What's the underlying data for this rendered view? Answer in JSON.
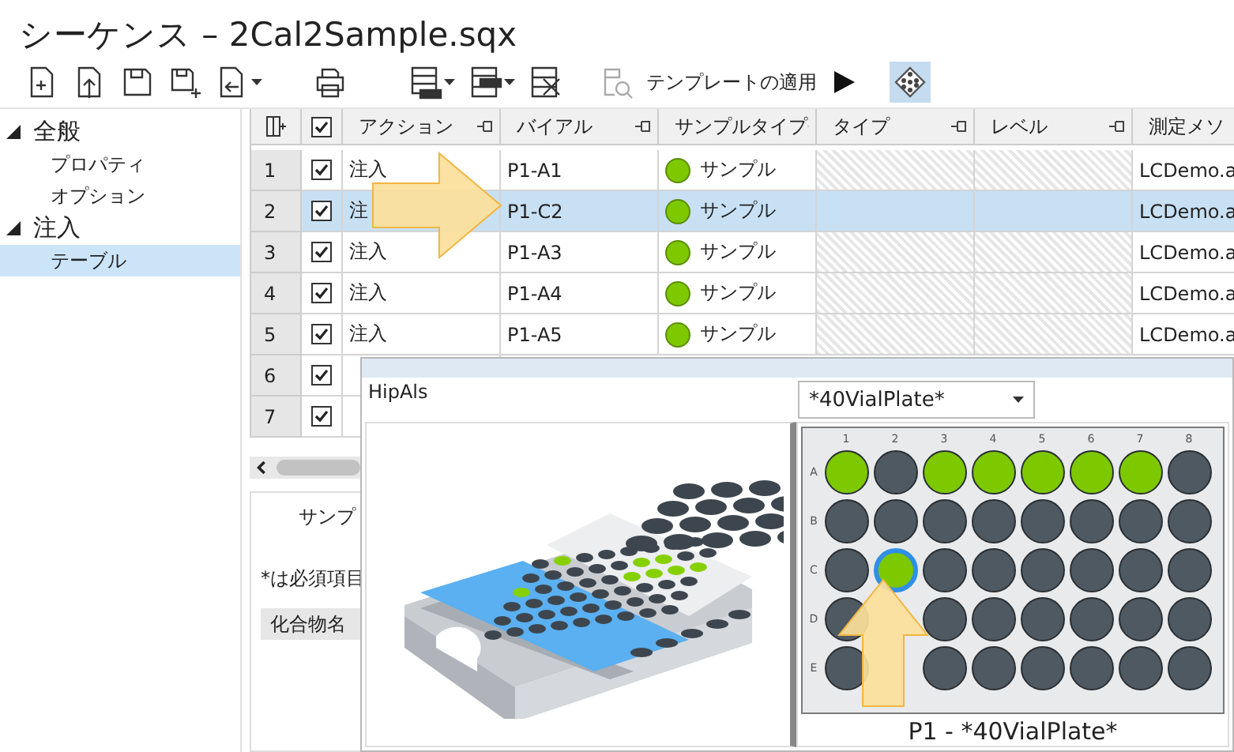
{
  "window": {
    "title": "シーケンス – 2Cal2Sample.sqx"
  },
  "toolbar": {
    "apply_template": {
      "label": "テンプレートの適用"
    },
    "plate_view": {
      "selected": true
    }
  },
  "sidebar": {
    "items": [
      {
        "label": "全般",
        "expanded": true,
        "selected": false,
        "children": [
          {
            "label": "プロパティ",
            "selected": false
          },
          {
            "label": "オプション",
            "selected": false
          }
        ]
      },
      {
        "label": "注入",
        "expanded": true,
        "selected": false,
        "children": [
          {
            "label": "テーブル",
            "selected": true
          }
        ]
      }
    ]
  },
  "table": {
    "header_checked": true,
    "columns": [
      {
        "label": "アクション",
        "locked": false
      },
      {
        "label": "バイアル",
        "locked": false
      },
      {
        "label": "サンプルタイプ",
        "locked": false
      },
      {
        "label": "タイプ",
        "locked": true
      },
      {
        "label": "レベル",
        "locked": true
      },
      {
        "label": "測定メソ",
        "locked": false
      }
    ],
    "rows": [
      {
        "number": "1",
        "checked": true,
        "selected": false,
        "action": "注入",
        "vial": "P1-A1",
        "sample_type": "サンプル",
        "color": "#7ec800",
        "method": "LCDemo.a"
      },
      {
        "number": "2",
        "checked": true,
        "selected": true,
        "action": "注",
        "vial": "P1-C2",
        "sample_type": "サンプル",
        "color": "#7ec800",
        "method": "LCDemo.a"
      },
      {
        "number": "3",
        "checked": true,
        "selected": false,
        "action": "注入",
        "vial": "P1-A3",
        "sample_type": "サンプル",
        "color": "#7ec800",
        "method": "LCDemo.a"
      },
      {
        "number": "4",
        "checked": true,
        "selected": false,
        "action": "注入",
        "vial": "P1-A4",
        "sample_type": "サンプル",
        "color": "#7ec800",
        "method": "LCDemo.a"
      },
      {
        "number": "5",
        "checked": true,
        "selected": false,
        "action": "注入",
        "vial": "P1-A5",
        "sample_type": "サンプル",
        "color": "#7ec800",
        "method": "LCDemo.a"
      },
      {
        "number": "6",
        "checked": true,
        "selected": false
      },
      {
        "number": "7",
        "checked": true,
        "selected": false
      }
    ]
  },
  "details": {
    "tab": "サンプ",
    "note": "*は必須項目",
    "column": "化合物名"
  },
  "plate_dialog": {
    "module": "HipAls",
    "plate_select": {
      "value": "*40VialPlate*"
    },
    "column_labels": [
      "1",
      "2",
      "3",
      "4",
      "5",
      "6",
      "7",
      "8"
    ],
    "rows": [
      {
        "label": "A",
        "wells": [
          {
            "filled": true,
            "selected": false
          },
          {
            "filled": false,
            "selected": false
          },
          {
            "filled": true,
            "selected": false
          },
          {
            "filled": true,
            "selected": false
          },
          {
            "filled": true,
            "selected": false
          },
          {
            "filled": true,
            "selected": false
          },
          {
            "filled": true,
            "selected": false
          },
          {
            "filled": false,
            "selected": false
          }
        ]
      },
      {
        "label": "B",
        "wells": [
          {
            "filled": false,
            "selected": false
          },
          {
            "filled": false,
            "selected": false
          },
          {
            "filled": false,
            "selected": false
          },
          {
            "filled": false,
            "selected": false
          },
          {
            "filled": false,
            "selected": false
          },
          {
            "filled": false,
            "selected": false
          },
          {
            "filled": false,
            "selected": false
          },
          {
            "filled": false,
            "selected": false
          }
        ]
      },
      {
        "label": "C",
        "wells": [
          {
            "filled": false,
            "selected": false
          },
          {
            "filled": true,
            "selected": true
          },
          {
            "filled": false,
            "selected": false
          },
          {
            "filled": false,
            "selected": false
          },
          {
            "filled": false,
            "selected": false
          },
          {
            "filled": false,
            "selected": false
          },
          {
            "filled": false,
            "selected": false
          },
          {
            "filled": false,
            "selected": false
          }
        ]
      },
      {
        "label": "D",
        "second_covered": true,
        "wells": [
          {
            "filled": false,
            "selected": false
          },
          {
            "filled": false,
            "selected": false
          },
          {
            "filled": false,
            "selected": false
          },
          {
            "filled": false,
            "selected": false
          },
          {
            "filled": false,
            "selected": false
          },
          {
            "filled": false,
            "selected": false
          },
          {
            "filled": false,
            "selected": false
          }
        ]
      },
      {
        "label": "E",
        "second_covered": true,
        "wells": [
          {
            "filled": false,
            "selected": false
          },
          {
            "filled": false,
            "selected": false
          },
          {
            "filled": false,
            "selected": false
          },
          {
            "filled": false,
            "selected": false
          },
          {
            "filled": false,
            "selected": false
          },
          {
            "filled": false,
            "selected": false
          },
          {
            "filled": false,
            "selected": false
          }
        ]
      }
    ],
    "caption": "P1 - *40VialPlate*"
  }
}
